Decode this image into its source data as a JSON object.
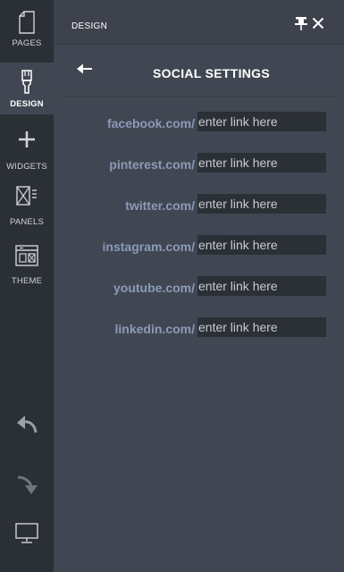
{
  "rail": {
    "items": [
      {
        "label": "PAGES",
        "icon": "page-icon"
      },
      {
        "label": "DESIGN",
        "icon": "brush-icon",
        "active": true
      },
      {
        "label": "WIDGETS",
        "icon": "plus-icon"
      },
      {
        "label": "PANELS",
        "icon": "panels-icon"
      },
      {
        "label": "THEME",
        "icon": "theme-icon"
      }
    ],
    "bottom": [
      "undo-icon",
      "redo-icon",
      "monitor-icon"
    ]
  },
  "header": {
    "title": "DESIGN"
  },
  "panel": {
    "title": "SOCIAL SETTINGS",
    "placeholder": "enter link here",
    "fields": [
      {
        "label": "facebook.com/",
        "value": ""
      },
      {
        "label": "pinterest.com/",
        "value": ""
      },
      {
        "label": "twitter.com/",
        "value": ""
      },
      {
        "label": "instagram.com/",
        "value": ""
      },
      {
        "label": "youtube.com/",
        "value": ""
      },
      {
        "label": "linkedin.com/",
        "value": ""
      }
    ]
  },
  "colors": {
    "rail_bg": "#2b2f36",
    "panel_bg": "#414752",
    "label": "#8c9ab8",
    "input_bg": "#2b2f36"
  }
}
